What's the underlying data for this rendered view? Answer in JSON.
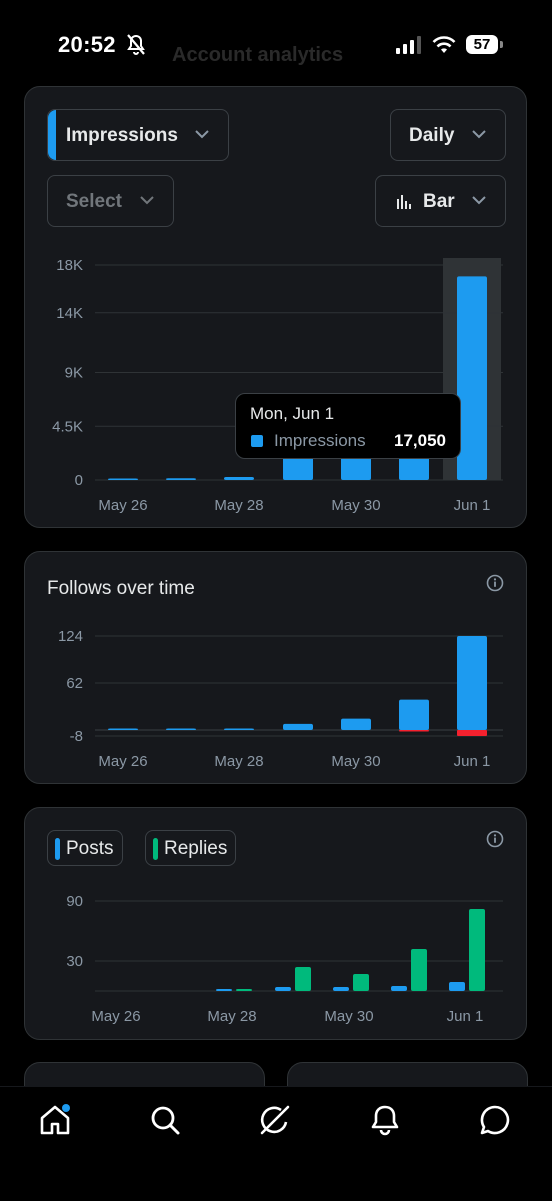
{
  "status": {
    "time": "20:52",
    "battery": "57",
    "icons": [
      "bell-slash-icon",
      "signal-icon",
      "wifi-icon",
      "battery-icon"
    ]
  },
  "header_ghost": "Account analytics",
  "controls": {
    "metric": "Impressions",
    "interval": "Daily",
    "compare": "Select",
    "chart_type": "Bar"
  },
  "tooltip": {
    "date": "Mon, Jun 1",
    "name": "Impressions",
    "value": "17,050"
  },
  "follows": {
    "title": "Follows over time"
  },
  "posts_replies": {
    "legend": [
      "Posts",
      "Replies"
    ]
  },
  "colors": {
    "blue": "#1d9bf0",
    "green": "#00ba7c",
    "red": "#f4212e",
    "hover": "#2f3336"
  },
  "nav": {
    "items": [
      "home-icon",
      "search-icon",
      "grok-icon",
      "notifications-icon",
      "messages-icon"
    ]
  },
  "chart_data": [
    {
      "type": "bar",
      "categories": [
        "May 26",
        "May 27",
        "May 28",
        "May 29",
        "May 30",
        "May 31",
        "Jun 1"
      ],
      "x_tick_labels": [
        "May 26",
        "May 28",
        "May 30",
        "Jun 1"
      ],
      "y_ticks": [
        "0",
        "4.5K",
        "9K",
        "14K",
        "18K"
      ],
      "ylim": [
        0,
        18000
      ],
      "series": [
        {
          "name": "Impressions",
          "values": [
            0,
            150,
            250,
            3000,
            3000,
            3000,
            17050
          ]
        }
      ],
      "highlight": "Jun 1"
    },
    {
      "type": "bar",
      "title": "Follows over time",
      "categories": [
        "May 26",
        "May 27",
        "May 28",
        "May 29",
        "May 30",
        "May 31",
        "Jun 1"
      ],
      "x_tick_labels": [
        "May 26",
        "May 28",
        "May 30",
        "Jun 1"
      ],
      "y_ticks": [
        "-8",
        "62",
        "124"
      ],
      "ylim": [
        -8,
        124
      ],
      "series": [
        {
          "values": [
            0,
            1,
            1,
            8,
            15,
            40,
            124
          ]
        },
        {
          "values": [
            0,
            0,
            0,
            0,
            0,
            -2,
            -8
          ]
        }
      ]
    },
    {
      "type": "bar",
      "categories": [
        "May 26",
        "May 27",
        "May 28",
        "May 29",
        "May 30",
        "May 31",
        "Jun 1"
      ],
      "x_tick_labels": [
        "May 26",
        "May 28",
        "May 30",
        "Jun 1"
      ],
      "y_ticks": [
        "30",
        "90"
      ],
      "ylim": [
        0,
        90
      ],
      "series": [
        {
          "name": "Posts",
          "values": [
            0,
            0,
            2,
            4,
            4,
            5,
            9
          ]
        },
        {
          "name": "Replies",
          "values": [
            0,
            0,
            2,
            24,
            17,
            42,
            82
          ]
        }
      ]
    }
  ]
}
